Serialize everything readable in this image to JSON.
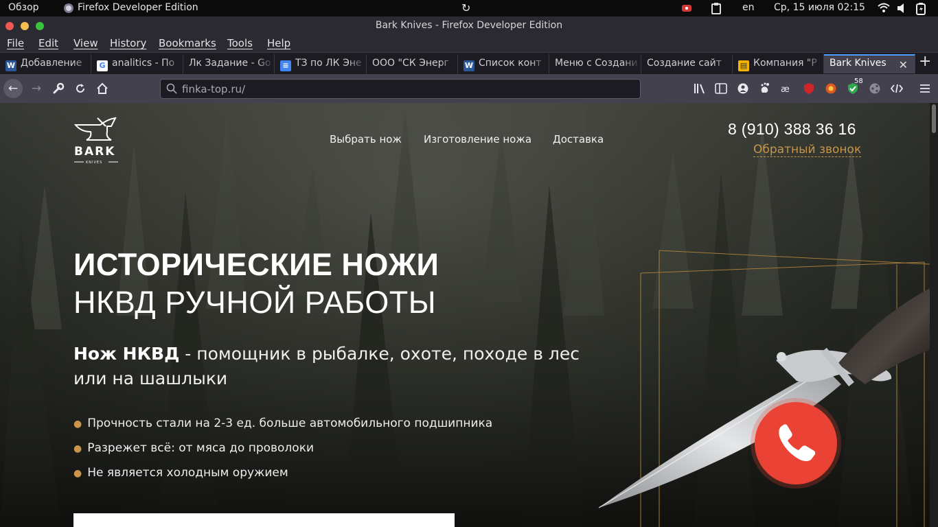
{
  "os_panel": {
    "overview": "Обзор",
    "app_name": "Firefox Developer Edition",
    "lang": "en",
    "clock": "Ср, 15 июля  02:15"
  },
  "window": {
    "title": "Bark Knives - Firefox Developer Edition"
  },
  "menu": [
    "File",
    "Edit",
    "View",
    "History",
    "Bookmarks",
    "Tools",
    "Help"
  ],
  "tabs": [
    {
      "label": "Добавление",
      "icon": "word-icon",
      "color": "#2b5797"
    },
    {
      "label": "analitics - По",
      "icon": "google-icon",
      "color": "#ffffff"
    },
    {
      "label": "Лк Задание - Go",
      "icon": "",
      "color": ""
    },
    {
      "label": "ТЗ по ЛК Эне",
      "icon": "docs-icon",
      "color": "#4285f4"
    },
    {
      "label": "ООО \"СК Энерг",
      "icon": "",
      "color": ""
    },
    {
      "label": "Список конт",
      "icon": "word-icon",
      "color": "#2b5797"
    },
    {
      "label": "Меню с Создани",
      "icon": "",
      "color": ""
    },
    {
      "label": "Создание сайт",
      "icon": "",
      "color": ""
    },
    {
      "label": "Компания \"Р",
      "icon": "slides-icon",
      "color": "#f4b400"
    },
    {
      "label": "Bark Knives",
      "icon": "",
      "color": "",
      "active": true
    }
  ],
  "navbar": {
    "url": "finka-top.ru/",
    "badge_count": "58"
  },
  "page": {
    "nav": [
      "Выбрать нож",
      "Изготовление ножа",
      "Доставка"
    ],
    "phone": "8 (910) 388 36 16",
    "callback": "Обратный звонок",
    "logo_text": "BARK",
    "logo_sub": "KNIVES",
    "heading_bold": "ИСТОРИЧЕСКИЕ НОЖИ",
    "heading_light": "НКВД РУЧНОЙ РАБОТЫ",
    "lead_bold": "Нож НКВД",
    "lead_rest": " - помощник в рыбалке, охоте, походе в лес или на шашлыки",
    "bullets": [
      "Прочность стали на 2-3 ед. больше автомобильного подшипника",
      "Разрежет всё: от мяса до проволоки",
      "Не является холодным оружием"
    ]
  },
  "colors": {
    "accent": "#c8954a",
    "call_button": "#ea4335",
    "tab_active_line": "#45a1ff"
  }
}
